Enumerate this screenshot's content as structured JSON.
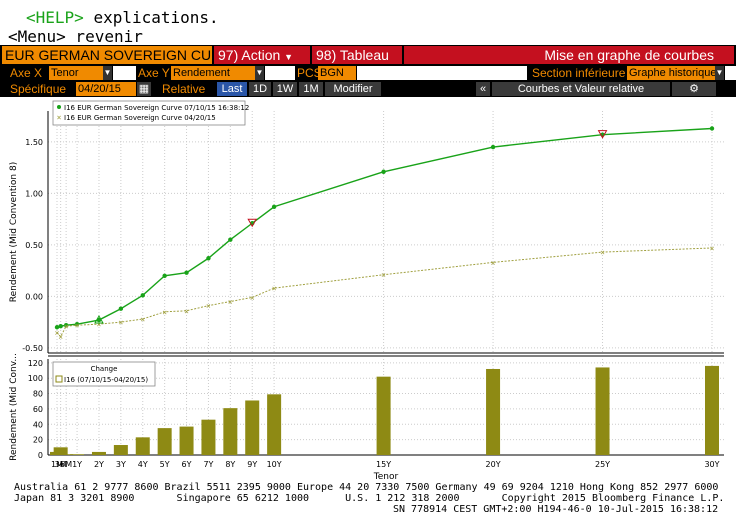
{
  "help": {
    "key": "<HELP>",
    "key_text": "explications.",
    "menu": "<Menu> revenir"
  },
  "toolbar": {
    "security": "EUR GERMAN SOVEREIGN CURVE",
    "action_num": "97)",
    "action_label": "Action",
    "table_num": "98)",
    "table_label": "Tableau",
    "mode_title": "Mise en graphe de courbes"
  },
  "controls": {
    "axe_x_label": "Axe X",
    "axe_x_value": "Tenor",
    "axe_y_label": "Axe Y",
    "axe_y_value": "Rendement",
    "pcs_label": "PCS",
    "pcs_value": "BGN",
    "section_label": "Section inférieure",
    "section_value": "Graphe historique",
    "specific_label": "Spécifique",
    "specific_date": "04/20/15",
    "relative_label": "Relative",
    "periods": [
      "Last",
      "1D",
      "1W",
      "1M"
    ],
    "modify_label": "Modifier",
    "collapse_label": "«",
    "right_panel_label": "Courbes et Valeur relative",
    "gear_icon": "gear-icon"
  },
  "chart_data": [
    {
      "type": "line",
      "title": "",
      "xlabel": "",
      "ylabel": "Rendement (Mid Convention 8)",
      "ylim": [
        -0.55,
        1.8
      ],
      "yticks": [
        "1.50",
        "1.00",
        "0.50",
        "0.00",
        "-0.50"
      ],
      "ytick_values": [
        1.5,
        1.0,
        0.5,
        0.0,
        -0.5
      ],
      "grid": true,
      "legend_position": "top-left",
      "categories": [
        "1M",
        "3M",
        "6M",
        "1Y",
        "2Y",
        "3Y",
        "4Y",
        "5Y",
        "6Y",
        "7Y",
        "8Y",
        "9Y",
        "10Y",
        "15Y",
        "20Y",
        "25Y",
        "30Y"
      ],
      "x_years": [
        0.083,
        0.25,
        0.5,
        1,
        2,
        3,
        4,
        5,
        6,
        7,
        8,
        9,
        10,
        15,
        20,
        25,
        30
      ],
      "series": [
        {
          "name": "I16 EUR German Sovereign Curve 07/10/15 16:38:12",
          "color": "#19a319",
          "values": [
            -0.3,
            -0.29,
            -0.28,
            -0.27,
            -0.23,
            -0.12,
            0.01,
            0.2,
            0.23,
            0.37,
            0.55,
            0.71,
            0.87,
            1.21,
            1.45,
            1.57,
            1.63
          ]
        },
        {
          "name": "I16 EUR German Sovereign Curve 04/20/15",
          "color": "#a0a040",
          "values": [
            -0.35,
            -0.39,
            -0.29,
            -0.28,
            -0.27,
            -0.25,
            -0.22,
            -0.15,
            -0.14,
            -0.09,
            -0.05,
            -0.01,
            0.08,
            0.21,
            0.33,
            0.43,
            0.47
          ]
        }
      ]
    },
    {
      "type": "bar",
      "title": "",
      "xlabel": "Tenor",
      "ylabel": "Rendement (Mid Conv...",
      "ylim": [
        0,
        125
      ],
      "yticks": [
        "120",
        "100",
        "80",
        "60",
        "40",
        "20",
        "0"
      ],
      "ytick_values": [
        120,
        100,
        80,
        60,
        40,
        20,
        0
      ],
      "legend_title": "Change",
      "series": [
        {
          "name": "I16 (07/10/15-04/20/15)",
          "color": "#8e8a14",
          "values": [
            4,
            10,
            1,
            1,
            4,
            13,
            23,
            35,
            37,
            46,
            61,
            71,
            79,
            102,
            112,
            114,
            116
          ]
        }
      ]
    }
  ],
  "footer": {
    "line1": "Australia 61 2 9777 8600 Brazil 5511 2395 9000 Europe 44 20 7330 7500 Germany 49 69 9204 1210 Hong Kong 852 2977 6000",
    "line2": "Japan 81 3 3201 8900       Singapore 65 6212 1000      U.S. 1 212 318 2000       Copyright 2015 Bloomberg Finance L.P.",
    "line3": "SN 778914 CEST GMT+2:00 H194-46-0 10-Jul-2015 16:38:12"
  }
}
